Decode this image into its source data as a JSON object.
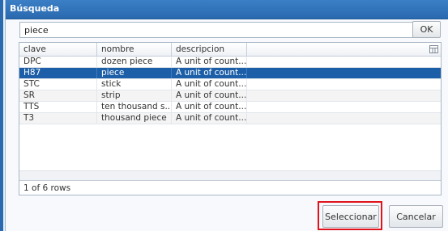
{
  "dialog": {
    "title": "Búsqueda"
  },
  "search": {
    "value": "piece",
    "ok_label": "OK"
  },
  "grid": {
    "columns": [
      "clave",
      "nombre",
      "descripcion"
    ],
    "rows": [
      {
        "clave": "DPC",
        "nombre": "dozen piece",
        "descripcion": "A unit of count...",
        "selected": false
      },
      {
        "clave": "H87",
        "nombre": "piece",
        "descripcion": "A unit of count...",
        "selected": true
      },
      {
        "clave": "STC",
        "nombre": "stick",
        "descripcion": "A unit of count...",
        "selected": false
      },
      {
        "clave": "SR",
        "nombre": "strip",
        "descripcion": "A unit of count...",
        "selected": false
      },
      {
        "clave": "TTS",
        "nombre": "ten thousand s...",
        "descripcion": "A unit of count...",
        "selected": false
      },
      {
        "clave": "T3",
        "nombre": "thousand piece",
        "descripcion": "A unit of count...",
        "selected": false
      }
    ],
    "footer": "1 of 6 rows",
    "menu_icon": "grid-options-icon"
  },
  "buttons": {
    "select_label": "Seleccionar",
    "cancel_label": "Cancelar"
  },
  "colors": {
    "titlebar": "#2a69ae",
    "selection": "#1c5fa8",
    "highlight": "#e0141a"
  }
}
